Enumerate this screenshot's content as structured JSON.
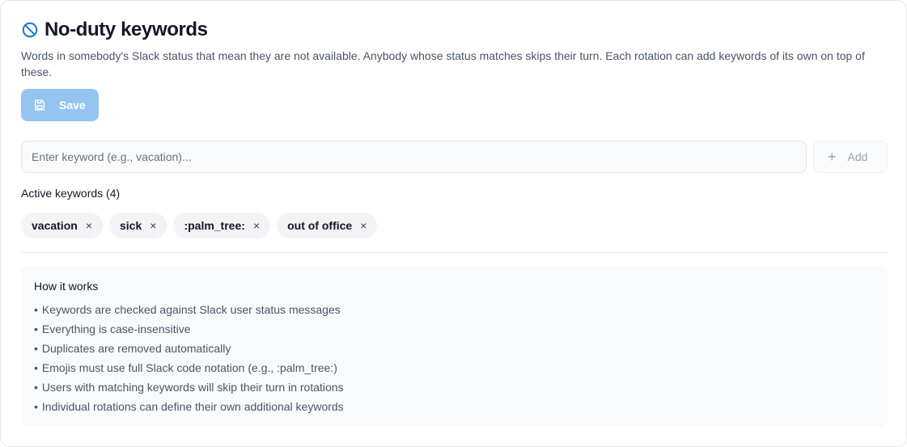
{
  "header": {
    "title": "No-duty keywords",
    "icon": "ban-icon",
    "description": "Words in somebody's Slack status that mean they are not available. Anybody whose status matches skips their turn. Each rotation can add keywords of its own on top of these."
  },
  "toolbar": {
    "save_label": "Save",
    "save_icon": "floppy-disk-icon"
  },
  "keyword_input": {
    "placeholder": "Enter keyword (e.g., vacation)...",
    "value": "",
    "add_label": "Add"
  },
  "active": {
    "label": "Active keywords (4)",
    "keywords": [
      "vacation",
      "sick",
      ":palm_tree:",
      "out of office"
    ],
    "remove_glyph": "×"
  },
  "info": {
    "title": "How it works",
    "bullet": "•",
    "items": [
      "Keywords are checked against Slack user status messages",
      "Everything is case-insensitive",
      "Duplicates are removed automatically",
      "Emojis must use full Slack code notation (e.g., :palm_tree:)",
      "Users with matching keywords will skip their turn in rotations",
      "Individual rotations can define their own additional keywords"
    ]
  },
  "colors": {
    "accent": "#2b7fd4",
    "save_button": "#93c5f0",
    "tag_bg": "#f1f3f6",
    "info_bg": "#f8fafc"
  }
}
